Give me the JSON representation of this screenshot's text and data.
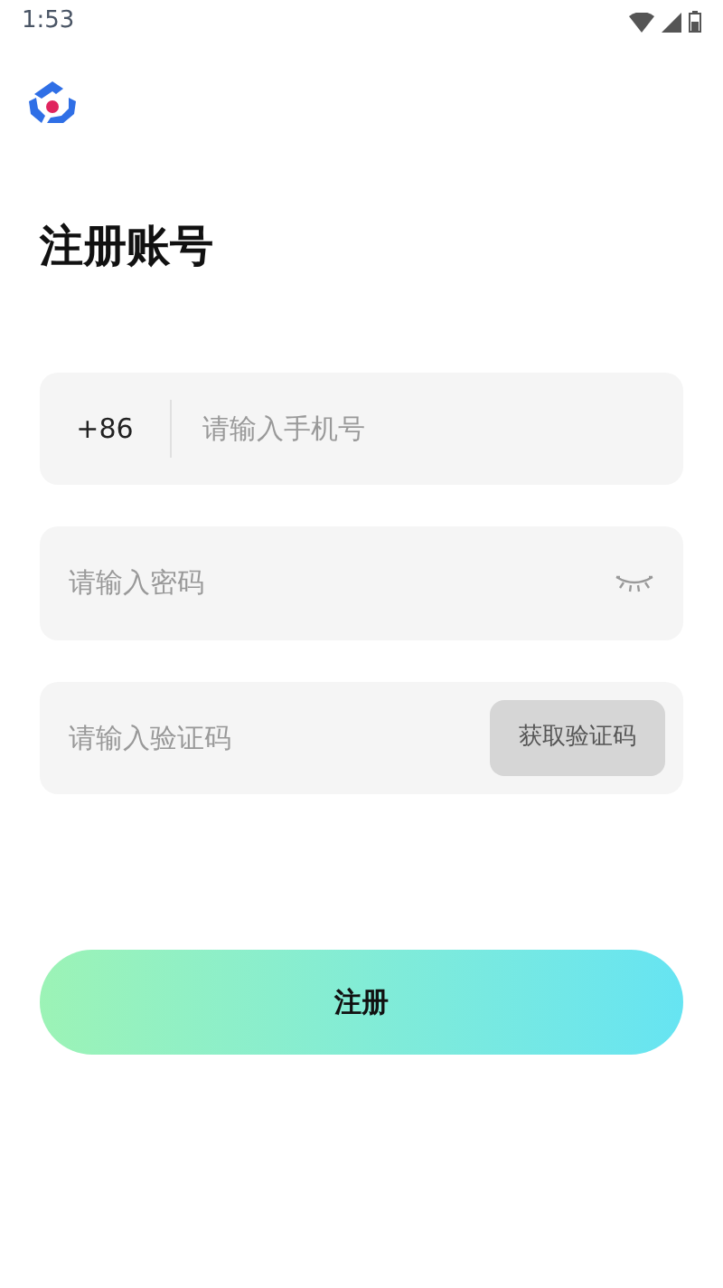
{
  "status_bar": {
    "time": "1:53"
  },
  "title": "注册账号",
  "phone_field": {
    "country_code": "+86",
    "placeholder": "请输入手机号"
  },
  "password_field": {
    "placeholder": "请输入密码",
    "password_visible": false
  },
  "code_field": {
    "placeholder": "请输入验证码",
    "button": "获取验证码"
  },
  "submit_button": "注册"
}
